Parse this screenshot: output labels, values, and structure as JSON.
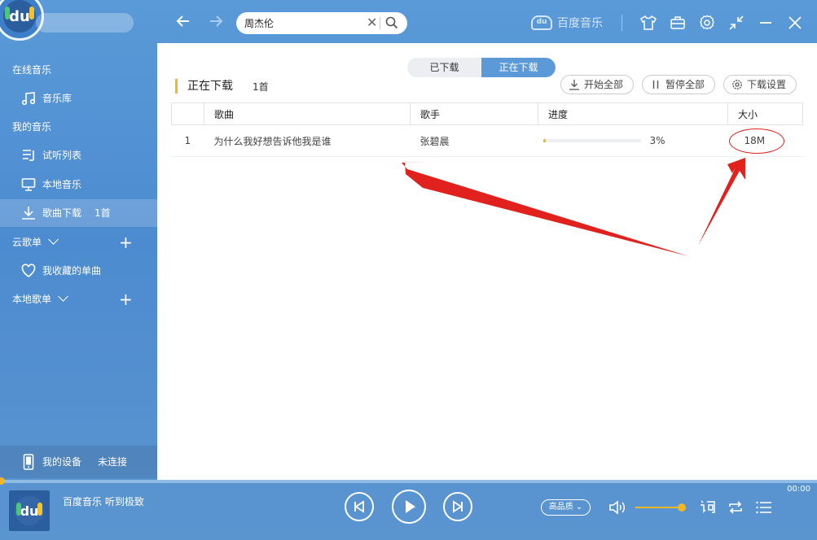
{
  "app": {
    "logo_text": "du",
    "brand_name": "百度音乐"
  },
  "search": {
    "value": "周杰伦",
    "placeholder": ""
  },
  "sidebar": {
    "sections": {
      "online": "在线音乐",
      "my_music": "我的音乐",
      "cloud_playlists": "云歌单",
      "local_playlists": "本地歌单"
    },
    "items": [
      {
        "label": "音乐库",
        "icon": "music-note-icon"
      },
      {
        "label": "试听列表",
        "icon": "playlist-icon"
      },
      {
        "label": "本地音乐",
        "icon": "monitor-icon"
      },
      {
        "label": "歌曲下载",
        "count": "1首",
        "icon": "download-icon",
        "active": true
      },
      {
        "label": "我收藏的单曲",
        "icon": "heart-icon"
      }
    ],
    "device": {
      "label": "我的设备",
      "status": "未连接"
    }
  },
  "content": {
    "tabs": [
      {
        "label": "已下载",
        "active": false
      },
      {
        "label": "正在下载",
        "active": true
      }
    ],
    "title": "正在下载",
    "count": "1首",
    "actions": {
      "start_all": "开始全部",
      "pause_all": "暂停全部",
      "settings": "下载设置"
    },
    "table": {
      "headers": [
        "",
        "歌曲",
        "歌手",
        "进度",
        "大小"
      ],
      "rows": [
        {
          "index": "1",
          "song": "为什么我好想告诉他我是谁",
          "artist": "张碧晨",
          "progress_text": "3%",
          "progress": 0.03,
          "size": "18M"
        }
      ]
    }
  },
  "player": {
    "time": "00:00",
    "now_playing": "百度音乐 听到极致",
    "quality": "高品质",
    "volume": 0.9
  },
  "colors": {
    "accent_blue": "#5b9ad6",
    "accent_yellow": "#f2b728",
    "annotation_red": "#e0211d"
  }
}
